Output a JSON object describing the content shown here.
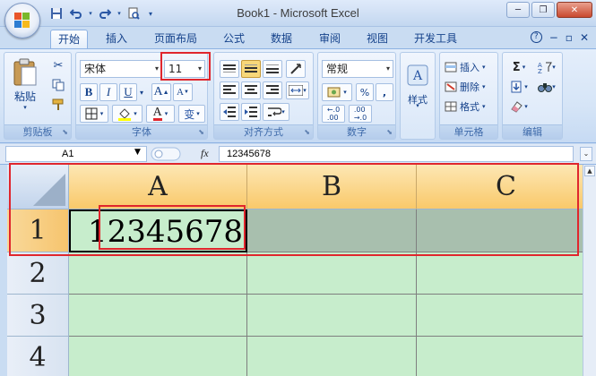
{
  "window": {
    "title": "Book1 - Microsoft Excel",
    "minimize_glyph": "─",
    "restore_glyph": "❐",
    "close_glyph": "✕"
  },
  "qat": {
    "save_icon": "save-icon",
    "undo_icon": "undo-icon",
    "redo_icon": "redo-icon",
    "print_preview_icon": "print-preview-icon",
    "customize_icon": "customize-qat-icon"
  },
  "tabs": [
    {
      "label": "开始",
      "active": true
    },
    {
      "label": "插入",
      "active": false
    },
    {
      "label": "页面布局",
      "active": false
    },
    {
      "label": "公式",
      "active": false
    },
    {
      "label": "数据",
      "active": false
    },
    {
      "label": "审阅",
      "active": false
    },
    {
      "label": "视图",
      "active": false
    },
    {
      "label": "开发工具",
      "active": false
    }
  ],
  "ribbon_right": {
    "help_glyph": "?",
    "min_glyph": "−",
    "restore_glyph": "▫",
    "close_glyph": "✕"
  },
  "clipboard": {
    "label": "剪贴板",
    "paste_label": "粘贴"
  },
  "font": {
    "label": "字体",
    "font_name": "宋体",
    "font_size": "11",
    "bold": "B",
    "italic": "I",
    "underline": "U",
    "grow": "A",
    "shrink": "A",
    "color_letter": "A",
    "phonetic": "变"
  },
  "alignment": {
    "label": "对齐方式"
  },
  "number": {
    "label": "数字",
    "format": "常规",
    "percent": "%",
    "comma": ","
  },
  "styles": {
    "label": "样式"
  },
  "cells": {
    "label": "单元格",
    "insert": "插入",
    "delete": "删除",
    "format": "格式"
  },
  "editing": {
    "label": "编辑",
    "sum": "Σ"
  },
  "formula_bar": {
    "name_box": "A1",
    "fx": "fx",
    "value": "12345678"
  },
  "sheet": {
    "columns": [
      "A",
      "B",
      "C"
    ],
    "rows": [
      "1",
      "2",
      "3",
      "4"
    ],
    "a1_value": "12345678"
  },
  "colors": {
    "annotation_red": "#e0262d",
    "sheet_green": "#c7edcc",
    "header_orange": "#f9c96a"
  }
}
